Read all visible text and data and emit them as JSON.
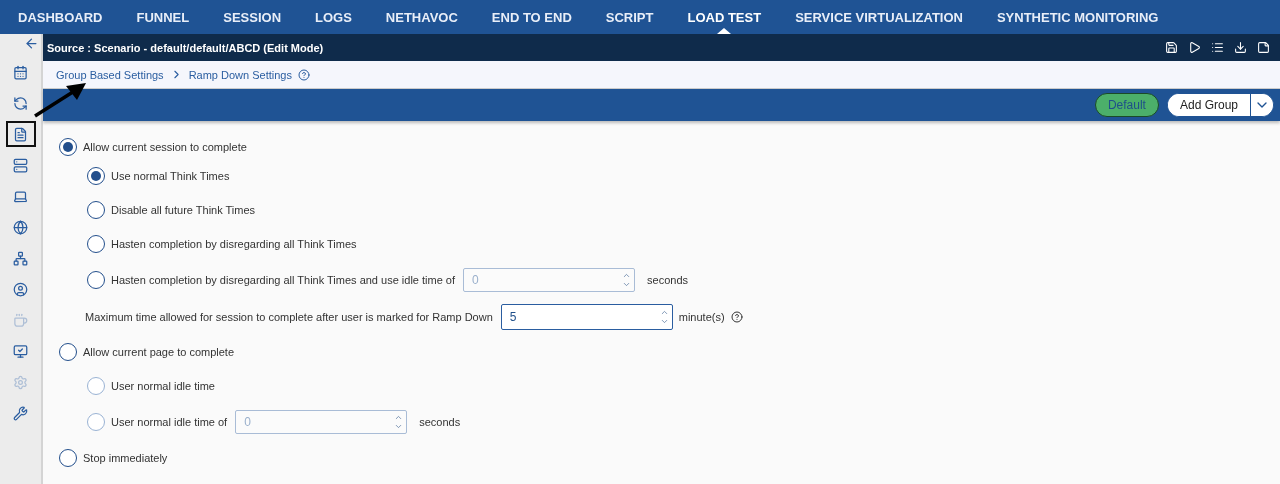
{
  "nav": {
    "tabs": [
      {
        "label": "DASHBOARD",
        "selected": false
      },
      {
        "label": "FUNNEL",
        "selected": false
      },
      {
        "label": "SESSION",
        "selected": false
      },
      {
        "label": "LOGS",
        "selected": false
      },
      {
        "label": "NETHAVOC",
        "selected": false
      },
      {
        "label": "END TO END",
        "selected": false
      },
      {
        "label": "SCRIPT",
        "selected": false
      },
      {
        "label": "LOAD TEST",
        "selected": true
      },
      {
        "label": "SERVICE VIRTUALIZATION",
        "selected": false
      },
      {
        "label": "SYNTHETIC MONITORING",
        "selected": false
      }
    ]
  },
  "sidebar": {
    "items": [
      {
        "selected": false,
        "disabled": false
      },
      {
        "selected": false,
        "disabled": false
      },
      {
        "selected": true,
        "disabled": false
      },
      {
        "selected": false,
        "disabled": false
      },
      {
        "selected": false,
        "disabled": false
      },
      {
        "selected": false,
        "disabled": false
      },
      {
        "selected": false,
        "disabled": false
      },
      {
        "selected": false,
        "disabled": false
      },
      {
        "selected": false,
        "disabled": true
      },
      {
        "selected": false,
        "disabled": false
      },
      {
        "selected": false,
        "disabled": true
      },
      {
        "selected": false,
        "disabled": false
      }
    ]
  },
  "source_bar": {
    "title": "Source : Scenario - default/default/ABCD (Edit Mode)"
  },
  "breadcrumb": [
    "Group Based Settings",
    "Ramp Down Settings"
  ],
  "toolbar": {
    "default_button": "Default",
    "add_button": "Add Group"
  },
  "groups": [
    {
      "label": "Allow current session to complete",
      "selected": true,
      "children": [
        {
          "kind": "radio",
          "label": "Use normal Think Times",
          "selected": true,
          "disabled": false
        },
        {
          "kind": "radio",
          "label": "Disable all future Think Times",
          "selected": false,
          "disabled": false
        },
        {
          "kind": "radio",
          "label": "Hasten completion by disregarding all Think Times",
          "selected": false,
          "disabled": false
        },
        {
          "kind": "radio",
          "label": "Hasten completion by disregarding all Think Times and use idle time of",
          "selected": false,
          "disabled": false,
          "field": {
            "value": "0",
            "disabled": true
          },
          "unit": "seconds"
        },
        {
          "kind": "limit",
          "label": "Maximum time allowed for session to complete after user is marked for Ramp Down",
          "field": {
            "value": "5",
            "disabled": false
          },
          "unit": "minute(s)"
        }
      ]
    },
    {
      "label": "Allow current page to complete",
      "selected": false,
      "children": [
        {
          "kind": "radio",
          "label": "User normal idle time",
          "selected": false,
          "disabled": true
        },
        {
          "kind": "radio",
          "label": "User normal idle time of",
          "selected": false,
          "disabled": true,
          "field": {
            "value": "0",
            "disabled": true
          },
          "unit": "seconds"
        }
      ]
    },
    {
      "label": "Stop immediately",
      "selected": false
    }
  ]
}
